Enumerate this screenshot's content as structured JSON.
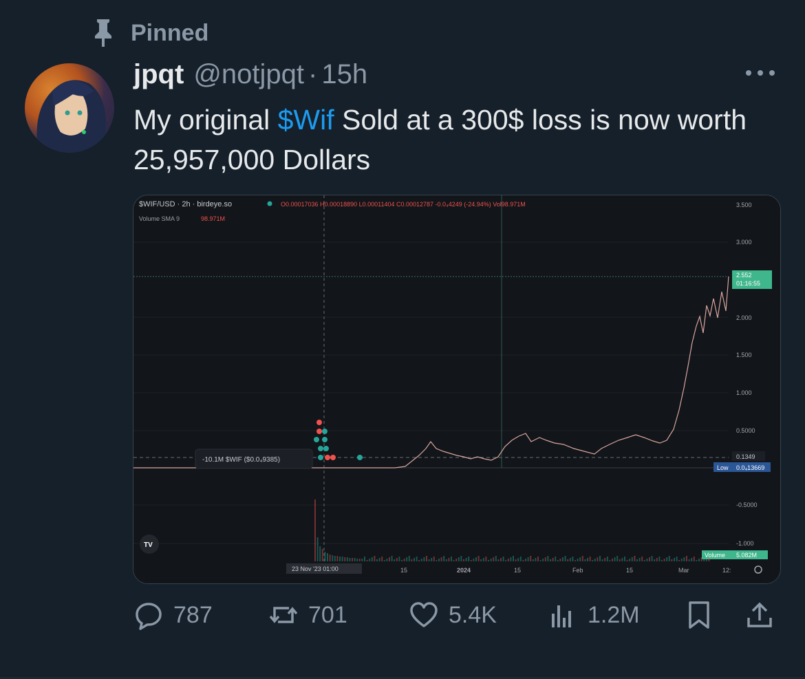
{
  "pinned_label": "Pinned",
  "author": {
    "name": "jpqt",
    "handle": "@notjpqt",
    "separator": "·",
    "time": "15h"
  },
  "tweet": {
    "before": "My original ",
    "cashtag": "$Wif",
    "after": " Sold at a 300$ loss is now worth 25,957,000 Dollars"
  },
  "chart": {
    "symbol": "$WIF/USD · 2h · birdeye.so",
    "ohlc": "O0.00017036 H0.00018890 L0.00011404 C0.00012787 -0.0₄4249 (-24.94%) Vol98.971M",
    "volume_sma": "Volume SMA 9",
    "volume_sma_value": "98.971M",
    "y_ticks": [
      "3.500",
      "3.000",
      "2.000",
      "1.500",
      "1.000",
      "0.5000",
      "-0.5000",
      "-1.000"
    ],
    "x_ticks": [
      "15",
      "2024",
      "15",
      "Feb",
      "15",
      "Mar",
      "12:"
    ],
    "date_label": "23 Nov '23  01:00",
    "price_label": "2.552",
    "time_label": "01:16:55",
    "marker_value": "0.1349",
    "low_label": "Low",
    "low_value": "0.0₄13669",
    "volume_label": "Volume",
    "volume_value": "5.082M",
    "trade_tooltip": "-10.1M $WIF ($0.0₄9385)",
    "logo": "TV",
    "colors": {
      "up": "#26a69a",
      "down": "#ef5350",
      "price_tag": "#3fb68b",
      "low_tag": "#2b5797"
    }
  },
  "actions": {
    "replies": "787",
    "reposts": "701",
    "likes": "5.4K",
    "views": "1.2M"
  }
}
